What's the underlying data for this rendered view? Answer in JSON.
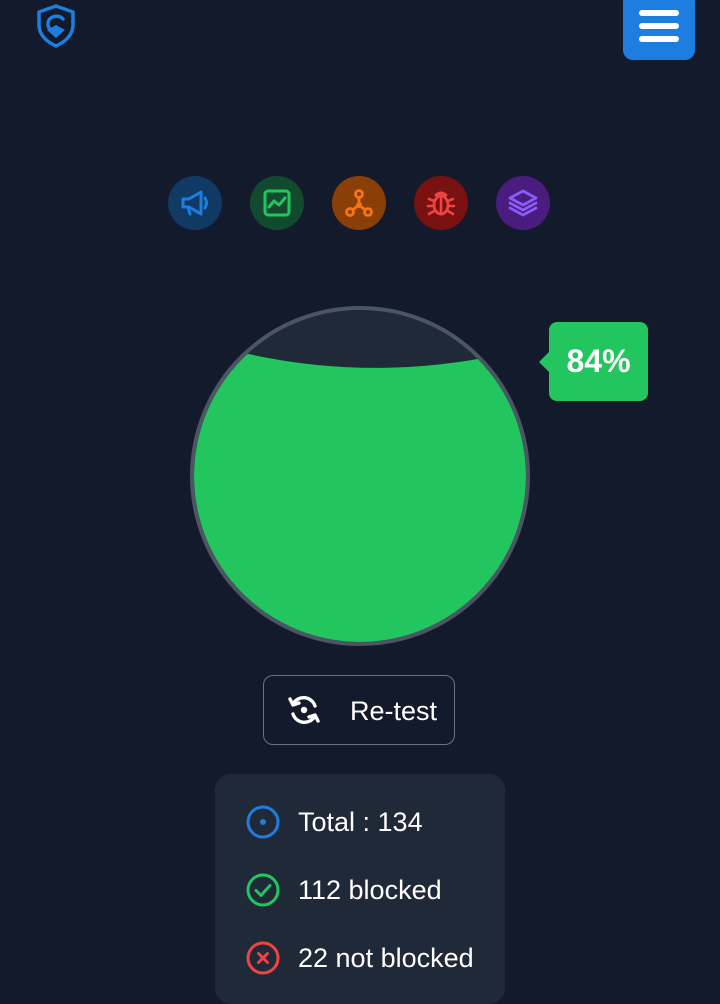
{
  "header": {
    "logo_icon": "shield-logo-icon",
    "menu_icon": "hamburger-menu-icon"
  },
  "categories": [
    {
      "name": "ads",
      "icon": "megaphone-icon",
      "color": "#1e7ee0"
    },
    {
      "name": "analytics",
      "icon": "chart-icon",
      "color": "#22c55e"
    },
    {
      "name": "tracking",
      "icon": "network-icon",
      "color": "#f97316"
    },
    {
      "name": "error-monitoring",
      "icon": "bug-icon",
      "color": "#ef4444"
    },
    {
      "name": "mix",
      "icon": "layers-icon",
      "color": "#8b5cf6"
    }
  ],
  "gauge": {
    "percent_label": "84%",
    "fill_fraction": 0.84,
    "fill_color": "#22c55e",
    "empty_color": "#202938"
  },
  "retest": {
    "label": "Re-test",
    "icon": "refresh-icon"
  },
  "stats": {
    "total": "Total : 134",
    "blocked": "112 blocked",
    "not_blocked": "22 not blocked"
  },
  "colors": {
    "background": "#121a2b",
    "accent": "#1e7ee0",
    "success": "#22c55e",
    "danger": "#ef4444"
  }
}
